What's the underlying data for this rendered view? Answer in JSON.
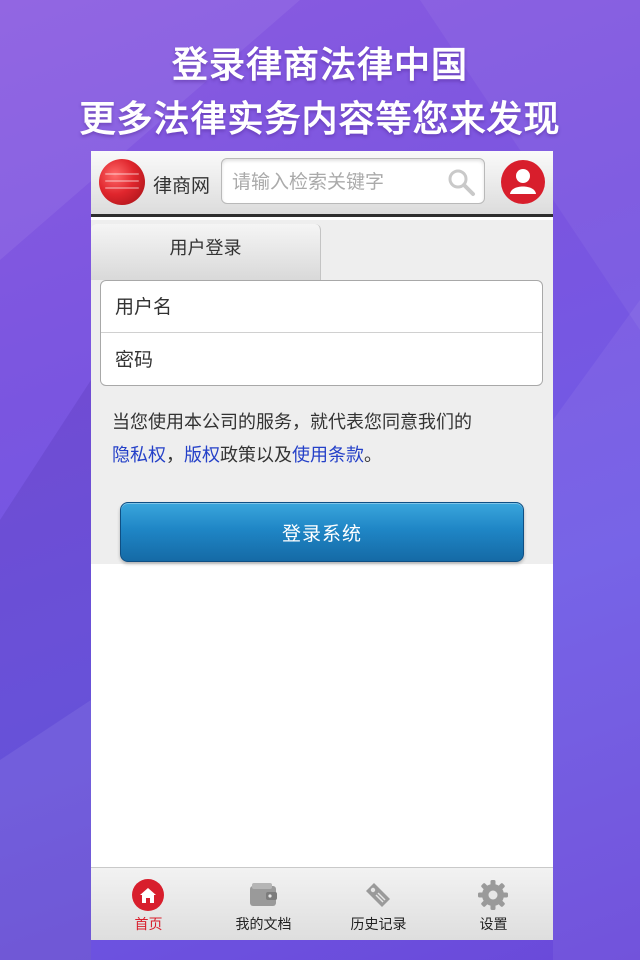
{
  "promo": {
    "line1": "登录律商法律中国",
    "line2": "更多法律实务内容等您来发现"
  },
  "header": {
    "site_name": "律商网",
    "search_placeholder": "请输入检索关键字",
    "logo_icon": "lexisnexis-logo-icon",
    "search_icon": "search-icon",
    "avatar_icon": "user-icon"
  },
  "login": {
    "tab_label": "用户登录",
    "username_placeholder": "用户名",
    "password_placeholder": "密码",
    "terms_prefix": "当您使用本公司的服务，就代表您同意我们的",
    "privacy_link": "隐私权",
    "sep": "，",
    "copyright_link": "版权",
    "terms_mid": "政策以及",
    "terms_link": "使用条款",
    "terms_end": "。",
    "button_label": "登录系统"
  },
  "nav": {
    "items": [
      {
        "label": "首页",
        "icon": "home-icon",
        "active": true
      },
      {
        "label": "我的文档",
        "icon": "wallet-icon",
        "active": false
      },
      {
        "label": "历史记录",
        "icon": "tag-icon",
        "active": false
      },
      {
        "label": "设置",
        "icon": "gear-icon",
        "active": false
      }
    ]
  },
  "colors": {
    "accent_red": "#d81e2c",
    "link_blue": "#2440c8",
    "button_blue": "#1f86c6",
    "background_purple": "#7a55e0"
  }
}
